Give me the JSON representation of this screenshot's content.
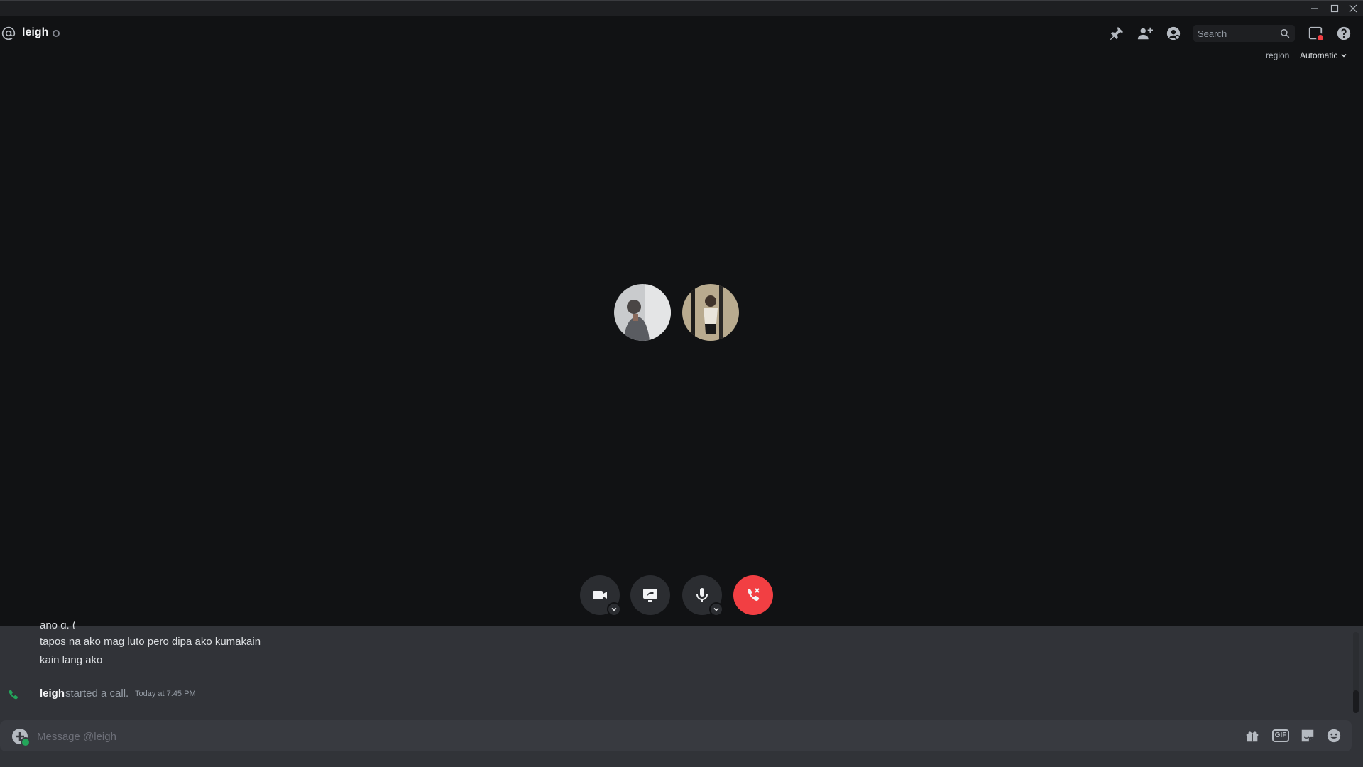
{
  "header": {
    "username": "leigh",
    "search_placeholder": "Search",
    "region_label": "region",
    "region_value": "Automatic"
  },
  "icons": {
    "pin": "pin-icon",
    "add_friend": "add-friend-to-dm-icon",
    "profile": "user-profile-icon",
    "inbox": "inbox-icon",
    "help": "help-icon"
  },
  "call": {
    "participants": [
      {
        "name": "participant-1",
        "color": "#8a8f97"
      },
      {
        "name": "participant-2",
        "color": "#b8a88c"
      }
    ],
    "controls": [
      "camera",
      "screen-share",
      "microphone",
      "disconnect"
    ]
  },
  "chat": {
    "messages": [
      {
        "text": "ano g. ("
      },
      {
        "text": "tapos na ako mag luto pero dipa ako kumakain"
      },
      {
        "text": "kain lang ako"
      }
    ],
    "system": {
      "username": "leigh",
      "action": "started a call.",
      "time": "Today at 7:45 PM"
    }
  },
  "composer": {
    "placeholder": "Message @leigh",
    "gif_label": "GIF"
  },
  "colors": {
    "background": "#111214",
    "chat_bg": "#313338",
    "danger": "#f23f43",
    "online": "#23a55a"
  }
}
